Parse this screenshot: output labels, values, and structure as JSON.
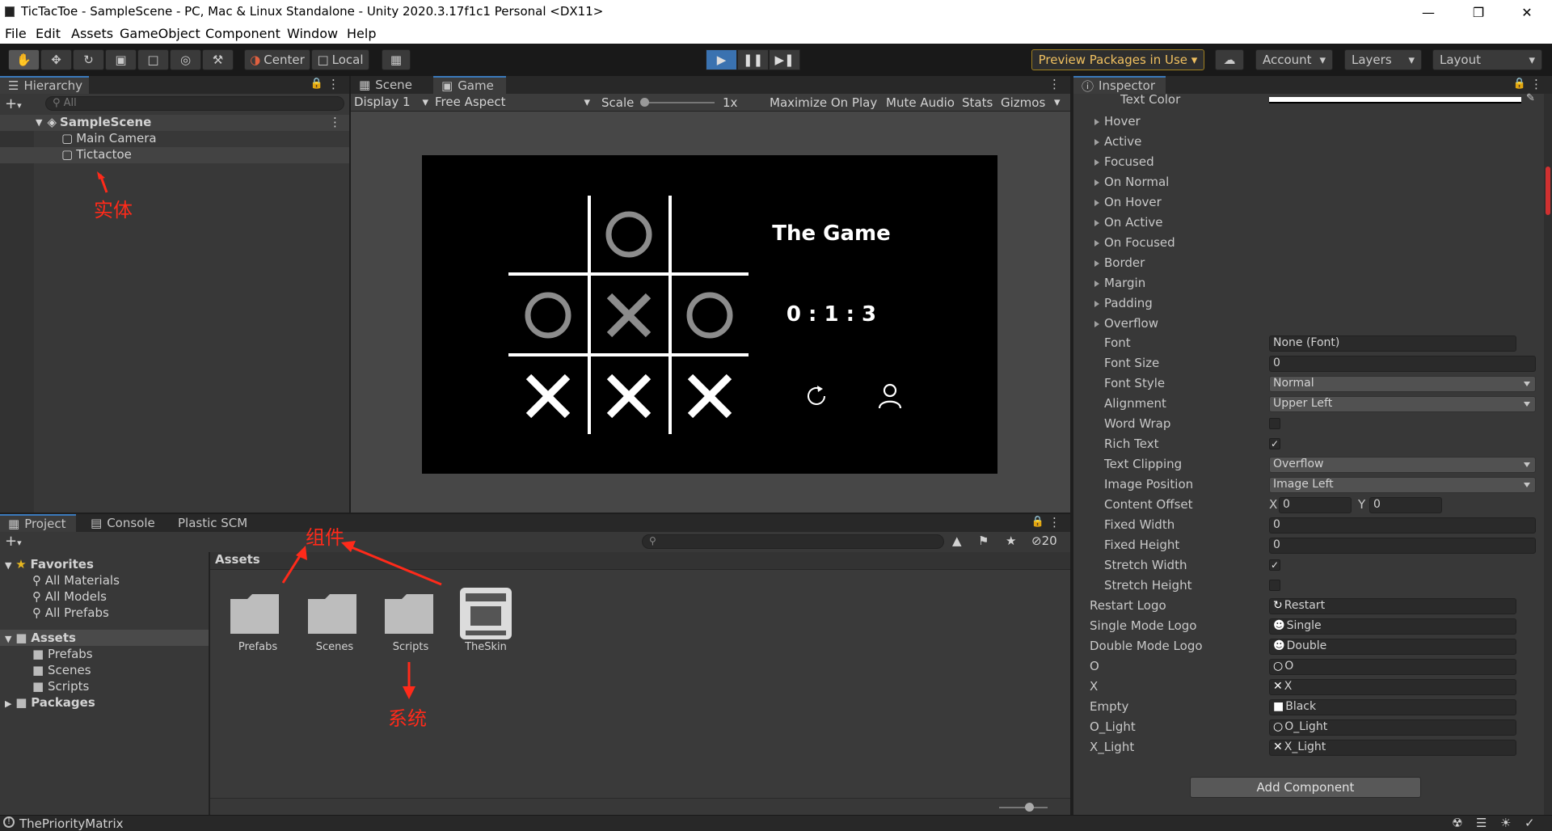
{
  "window": {
    "title": "TicTacToe - SampleScene - PC, Mac & Linux Standalone - Unity 2020.3.17f1c1 Personal <DX11>"
  },
  "menu": [
    "File",
    "Edit",
    "Assets",
    "GameObject",
    "Component",
    "Window",
    "Help"
  ],
  "toolbar": {
    "center_label": "Center",
    "local_label": "Local",
    "preview_packages": "Preview Packages in Use",
    "account": "Account",
    "layers": "Layers",
    "layout": "Layout"
  },
  "hierarchy": {
    "tab": "Hierarchy",
    "search_placeholder": "All",
    "scene": "SampleScene",
    "items": [
      "Main Camera",
      "Tictactoe"
    ],
    "annotation": "实体"
  },
  "game_view": {
    "tabs": [
      "Scene",
      "Game"
    ],
    "display": "Display 1",
    "aspect": "Free Aspect",
    "scale_label": "Scale",
    "scale_value": "1x",
    "maximize": "Maximize On Play",
    "mute": "Mute Audio",
    "stats": "Stats",
    "gizmos": "Gizmos",
    "title": "The Game",
    "score": "0 : 1 : 3",
    "board": [
      [
        "",
        "O",
        ""
      ],
      [
        "O",
        "X",
        "O"
      ],
      [
        "X",
        "X",
        "X"
      ]
    ],
    "board_colors": {
      "O": "#8c8c8c",
      "X_light": "#8c8c8c",
      "X": "#ffffff"
    }
  },
  "project": {
    "tabs": [
      "Project",
      "Console",
      "Plastic SCM"
    ],
    "hidden_count": "20",
    "favorites_label": "Favorites",
    "favorites": [
      "All Materials",
      "All Models",
      "All Prefabs"
    ],
    "assets_label": "Assets",
    "asset_folders": [
      "Prefabs",
      "Scenes",
      "Scripts"
    ],
    "packages_label": "Packages",
    "breadcrumb": "Assets",
    "grid_items": [
      "Prefabs",
      "Scenes",
      "Scripts",
      "TheSkin"
    ],
    "annotation_component": "组件",
    "annotation_system": "系统"
  },
  "inspector": {
    "tab": "Inspector",
    "text_color_label": "Text Color",
    "foldouts": [
      "Hover",
      "Active",
      "Focused",
      "On Normal",
      "On Hover",
      "On Active",
      "On Focused",
      "Border",
      "Margin",
      "Padding",
      "Overflow"
    ],
    "font_label": "Font",
    "font_value": "None (Font)",
    "font_size_label": "Font Size",
    "font_size_value": "0",
    "font_style_label": "Font Style",
    "font_style_value": "Normal",
    "alignment_label": "Alignment",
    "alignment_value": "Upper Left",
    "word_wrap_label": "Word Wrap",
    "rich_text_label": "Rich Text",
    "text_clipping_label": "Text Clipping",
    "text_clipping_value": "Overflow",
    "image_position_label": "Image Position",
    "image_position_value": "Image Left",
    "content_offset_label": "Content Offset",
    "offset_x": "0",
    "offset_y": "0",
    "x_label": "X",
    "y_label": "Y",
    "fixed_width_label": "Fixed Width",
    "fixed_width_value": "0",
    "fixed_height_label": "Fixed Height",
    "fixed_height_value": "0",
    "stretch_width_label": "Stretch Width",
    "stretch_height_label": "Stretch Height",
    "refs": [
      {
        "label": "Restart Logo",
        "value": "Restart"
      },
      {
        "label": "Single Mode Logo",
        "value": "Single"
      },
      {
        "label": "Double Mode Logo",
        "value": "Double"
      },
      {
        "label": "O",
        "value": "O"
      },
      {
        "label": "X",
        "value": "X"
      },
      {
        "label": "Empty",
        "value": "Black"
      },
      {
        "label": "O_Light",
        "value": "O_Light"
      },
      {
        "label": "X_Light",
        "value": "X_Light"
      }
    ],
    "add_component": "Add Component"
  },
  "statusbar": {
    "text": "ThePriorityMatrix"
  }
}
